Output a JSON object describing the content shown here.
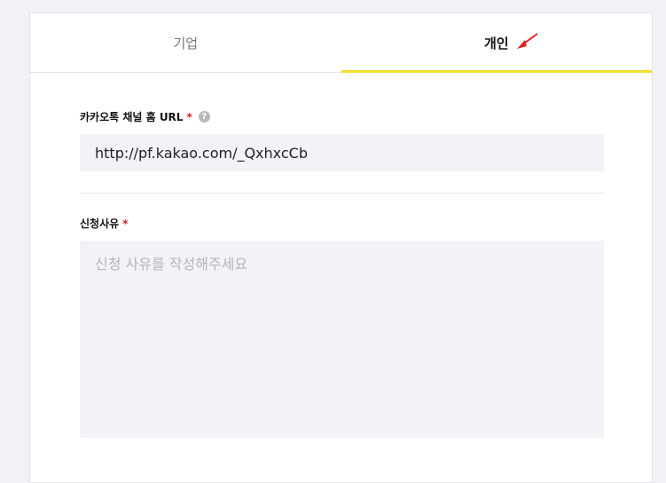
{
  "tabs": [
    {
      "label": "기업",
      "active": false
    },
    {
      "label": "개인",
      "active": true
    }
  ],
  "form": {
    "channel_url_label": "카카오톡 채널 홈 URL",
    "channel_url_required": "*",
    "channel_url_help_icon": "help-circle-icon",
    "channel_url_value": "http://pf.kakao.com/_QxhxcCb",
    "reason_label": "신청사유",
    "reason_required": "*",
    "reason_placeholder": "신청 사유를 작성해주세요"
  },
  "colors": {
    "accent": "#f2de2a",
    "required": "#e0201c",
    "input_bg": "#f2f3f6",
    "annotation_arrow": "#e0201c"
  }
}
